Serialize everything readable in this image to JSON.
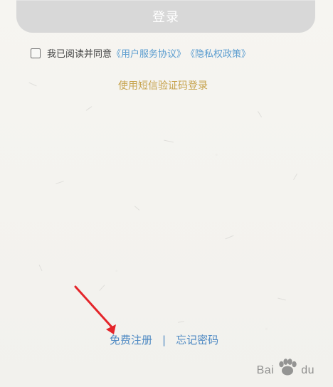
{
  "login_button": {
    "label": "登录"
  },
  "agreement": {
    "prefix": "我已阅读并同意",
    "user_agreement": "《用户服务协议》",
    "privacy_policy": "《隐私权政策》"
  },
  "sms_login": {
    "label": "使用短信验证码登录"
  },
  "footer_links": {
    "register": "免费注册",
    "separator": "|",
    "forgot_password": "忘记密码"
  },
  "watermark": {
    "brand_left": "Bai",
    "brand_right": "du",
    "icon": "baidu-paw-icon"
  },
  "colors": {
    "background": "#f4f3ef",
    "button": "#d8d8d8",
    "accent_link": "#5a9ccf",
    "sms_link": "#c6a24b",
    "annotation_arrow": "#e4252a"
  }
}
